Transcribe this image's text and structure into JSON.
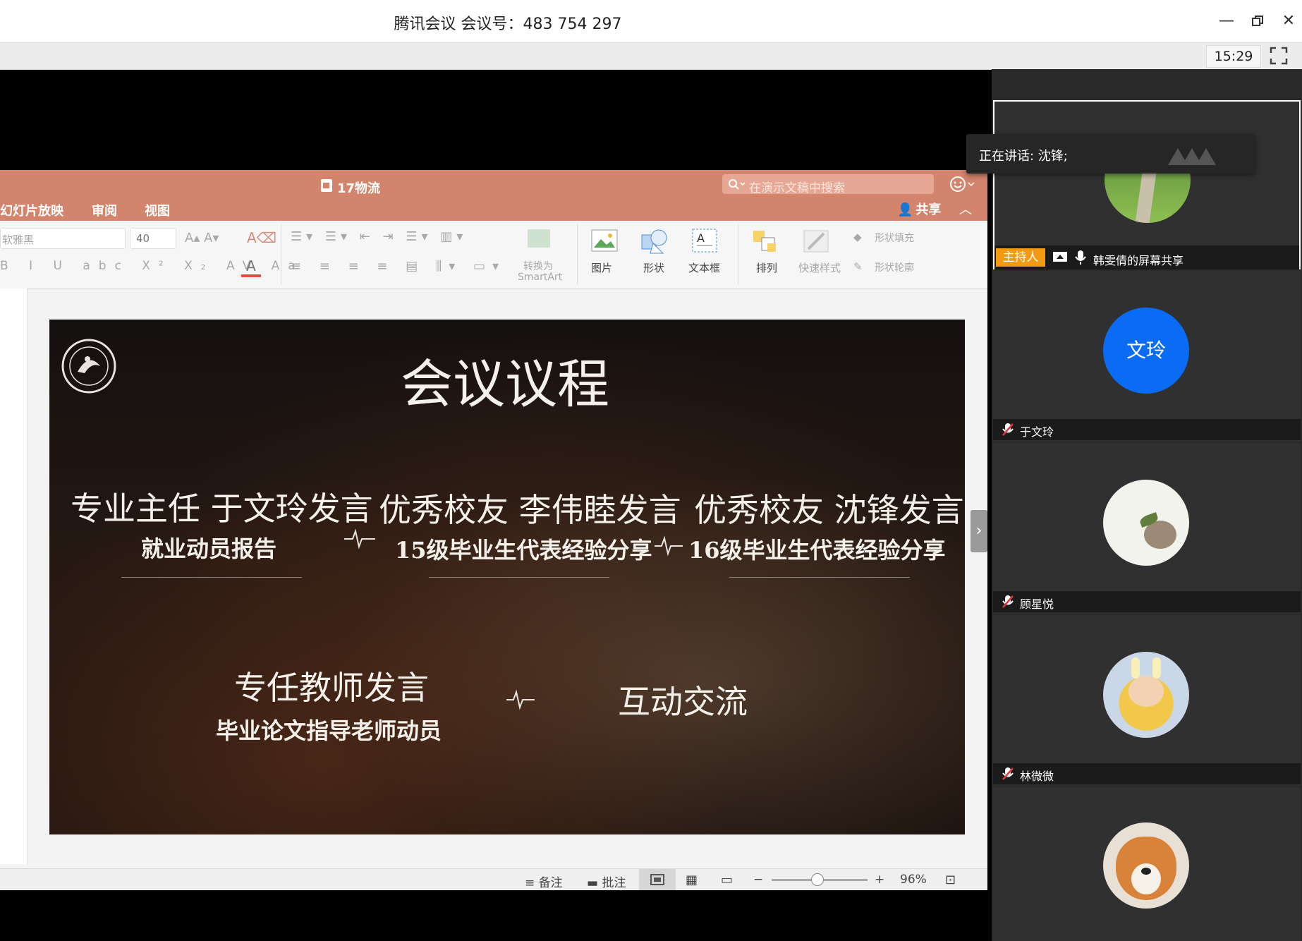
{
  "window": {
    "title": "腾讯会议 会议号：483 754 297",
    "clock": "15:29"
  },
  "ppt": {
    "doc_title": "17物流",
    "search_placeholder": "在演示文稿中搜索",
    "tabs": [
      "幻灯片放映",
      "审阅",
      "视图"
    ],
    "share_label": "共享",
    "font_name": "软雅黑",
    "font_size": "40",
    "ribbon": {
      "convert_smartart_1": "转换为",
      "convert_smartart_2": "SmartArt",
      "picture": "图片",
      "shape": "形状",
      "textbox": "文本框",
      "arrange": "排列",
      "quick_styles": "快速样式",
      "shape_fill": "形状填充",
      "shape_outline": "形状轮廓"
    },
    "status": {
      "notes": "备注",
      "comments": "批注",
      "zoom": "96%"
    }
  },
  "slide": {
    "title": "会议议程",
    "items": [
      {
        "heading": "专业主任 于文玲发言",
        "sub": "就业动员报告"
      },
      {
        "heading": "优秀校友 李伟睦发言",
        "sub": "15级毕业生代表经验分享"
      },
      {
        "heading": "优秀校友 沈锋发言",
        "sub": "16级毕业生代表经验分享"
      },
      {
        "heading": "专任教师发言",
        "sub": "毕业论文指导老师动员"
      },
      {
        "heading": "互动交流",
        "sub": ""
      }
    ]
  },
  "panel": {
    "speaking": "正在讲话: 沈锋;",
    "host_badge": "主持人",
    "screen_share_label": "韩雯倩的屏幕共享",
    "participants": [
      {
        "name": "于文玲",
        "avatar_text": "文玲"
      },
      {
        "name": "顾星悦"
      },
      {
        "name": "林微微"
      }
    ]
  },
  "colors": {
    "ppt_accent": "#d3846d",
    "host_badge": "#f39a12",
    "avatar_blue": "#0a6cf5"
  }
}
